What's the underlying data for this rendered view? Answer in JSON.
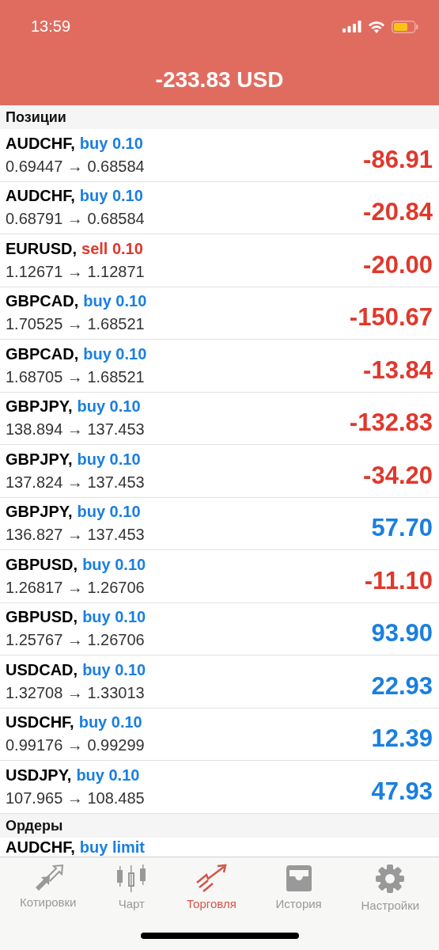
{
  "status_bar": {
    "time": "13:59"
  },
  "header": {
    "total": "-233.83 USD"
  },
  "positions": {
    "title": "Позиции",
    "rows": [
      {
        "symbol": "AUDCHF,",
        "sell": false,
        "order": "buy 0.10",
        "prices": "0.69447 → 0.68584",
        "profit": "-86.91",
        "negative": true
      },
      {
        "symbol": "AUDCHF,",
        "sell": false,
        "order": "buy 0.10",
        "prices": "0.68791 → 0.68584",
        "profit": "-20.84",
        "negative": true
      },
      {
        "symbol": "EURUSD,",
        "sell": true,
        "order": "sell 0.10",
        "prices": "1.12671 → 1.12871",
        "profit": "-20.00",
        "negative": true
      },
      {
        "symbol": "GBPCAD,",
        "sell": false,
        "order": "buy 0.10",
        "prices": "1.70525 → 1.68521",
        "profit": "-150.67",
        "negative": true
      },
      {
        "symbol": "GBPCAD,",
        "sell": false,
        "order": "buy 0.10",
        "prices": "1.68705 → 1.68521",
        "profit": "-13.84",
        "negative": true
      },
      {
        "symbol": "GBPJPY,",
        "sell": false,
        "order": "buy 0.10",
        "prices": "138.894 → 137.453",
        "profit": "-132.83",
        "negative": true
      },
      {
        "symbol": "GBPJPY,",
        "sell": false,
        "order": "buy 0.10",
        "prices": "137.824 → 137.453",
        "profit": "-34.20",
        "negative": true
      },
      {
        "symbol": "GBPJPY,",
        "sell": false,
        "order": "buy 0.10",
        "prices": "136.827 → 137.453",
        "profit": "57.70",
        "negative": false
      },
      {
        "symbol": "GBPUSD,",
        "sell": false,
        "order": "buy 0.10",
        "prices": "1.26817 → 1.26706",
        "profit": "-11.10",
        "negative": true
      },
      {
        "symbol": "GBPUSD,",
        "sell": false,
        "order": "buy 0.10",
        "prices": "1.25767 → 1.26706",
        "profit": "93.90",
        "negative": false
      },
      {
        "symbol": "USDCAD,",
        "sell": false,
        "order": "buy 0.10",
        "prices": "1.32708 → 1.33013",
        "profit": "22.93",
        "negative": false
      },
      {
        "symbol": "USDCHF,",
        "sell": false,
        "order": "buy 0.10",
        "prices": "0.99176 → 0.99299",
        "profit": "12.39",
        "negative": false
      },
      {
        "symbol": "USDJPY,",
        "sell": false,
        "order": "buy 0.10",
        "prices": "107.965 → 108.485",
        "profit": "47.93",
        "negative": false
      }
    ]
  },
  "orders": {
    "title": "Ордеры",
    "rows": [
      {
        "symbol": "AUDCHF,",
        "sell": false,
        "order": "buy limit"
      }
    ]
  },
  "tab_bar": [
    {
      "label": "Котировки",
      "kind": "quotes",
      "selected": false
    },
    {
      "label": "Чарт",
      "kind": "chart",
      "selected": false
    },
    {
      "label": "Торговля",
      "kind": "trade",
      "selected": true
    },
    {
      "label": "История",
      "kind": "history",
      "selected": false
    },
    {
      "label": "Настройки",
      "kind": "settings",
      "selected": false
    }
  ]
}
